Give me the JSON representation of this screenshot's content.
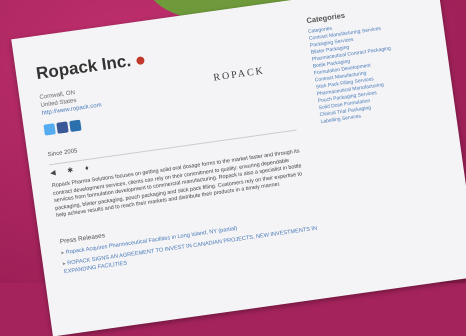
{
  "company": {
    "name": "Ropack Inc.",
    "logo_text": "ROPACK",
    "address_lines": [
      "Cornwall, ON",
      "United States"
    ],
    "url": "http://www.ropack.com",
    "since": "Since 2005"
  },
  "tabs": [
    "◀",
    "✱",
    "♦"
  ],
  "description": "Ropack Pharma Solutions focuses on getting solid oral dosage forms to the market faster and through its contract development services, clients can rely on their commitment to quality: ensuring dependable services from formulation development to commercial manufacturing. Ropack is also a specialist in bottle packaging, blister packaging, pouch packaging and stick pack filling. Customers rely on their expertise to help achieve results and to reach their markets and distribute their products in a timely manner.",
  "press_releases": {
    "heading": "Press Releases",
    "items": [
      "Ropack Acquires Pharmaceutical Facilities in Long Island, NY (partial)",
      "ROPACK SIGNS AN AGREEMENT TO INVEST IN CANADIAN PROJECTS, NEW INVESTMENTS IN EXPANDING FACILITIES"
    ]
  },
  "categories": {
    "heading": "Categories",
    "items": [
      "Categories",
      "Contract Manufacturing Services",
      "Packaging Services",
      "Blister Packaging",
      "Pharmaceutical Contract Packaging",
      "Bottle Packaging",
      "Formulation Development",
      "Contract Manufacturing",
      "Stick Pack Filling Services",
      "Pharmaceutical Manufacturing",
      "Pouch Packaging Services",
      "Solid Dose Formulation",
      "Clinical Trial Packaging",
      "Labelling Services"
    ]
  }
}
